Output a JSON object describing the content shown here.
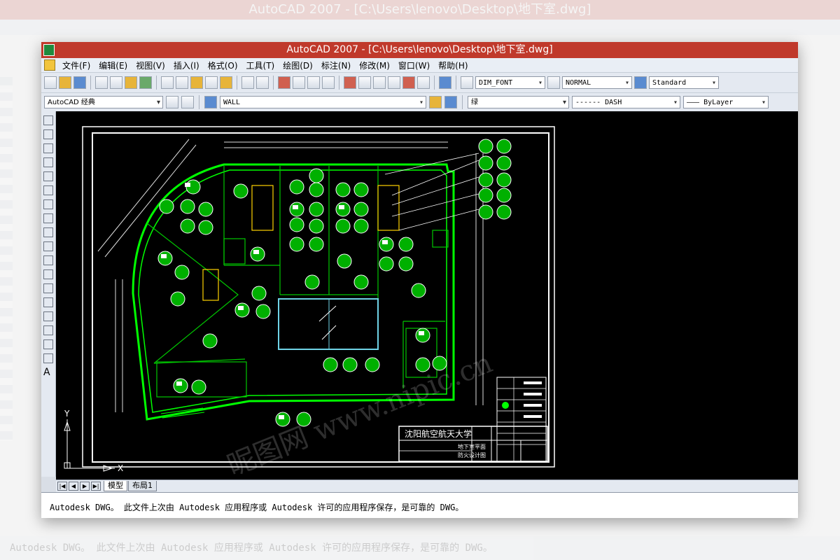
{
  "window": {
    "title": "AutoCAD 2007 - [C:\\Users\\lenovo\\Desktop\\地下室.dwg]"
  },
  "menu": [
    "文件(F)",
    "编辑(E)",
    "视图(V)",
    "插入(I)",
    "格式(O)",
    "工具(T)",
    "绘图(D)",
    "标注(N)",
    "修改(M)",
    "窗口(W)",
    "帮助(H)"
  ],
  "toolbar": {
    "dim_style": "DIM_FONT",
    "text_style": "NORMAL",
    "table_style": "Standard"
  },
  "toolbar2": {
    "workspace": "AutoCAD 经典",
    "layer": "WALL",
    "color": "绿",
    "linetype": "------ DASH",
    "lineweight": "——— ByLayer"
  },
  "title_block": {
    "school": "沈阳航空航天大学",
    "drawing": "地下室平面",
    "drawing2": "防火设计图"
  },
  "ucs": {
    "x": "X",
    "y": "Y"
  },
  "tabs": {
    "model": "模型",
    "layout": "布局1"
  },
  "command": {
    "line": "Autodesk DWG。  此文件上次由 Autodesk 应用程序或 Autodesk 许可的应用程序保存，是可靠的 DWG。"
  },
  "watermark": "昵图网 www.nipic.cn",
  "colors": {
    "title": "#c0392b",
    "wall": "#00ff00",
    "frame": "#ffffff"
  }
}
